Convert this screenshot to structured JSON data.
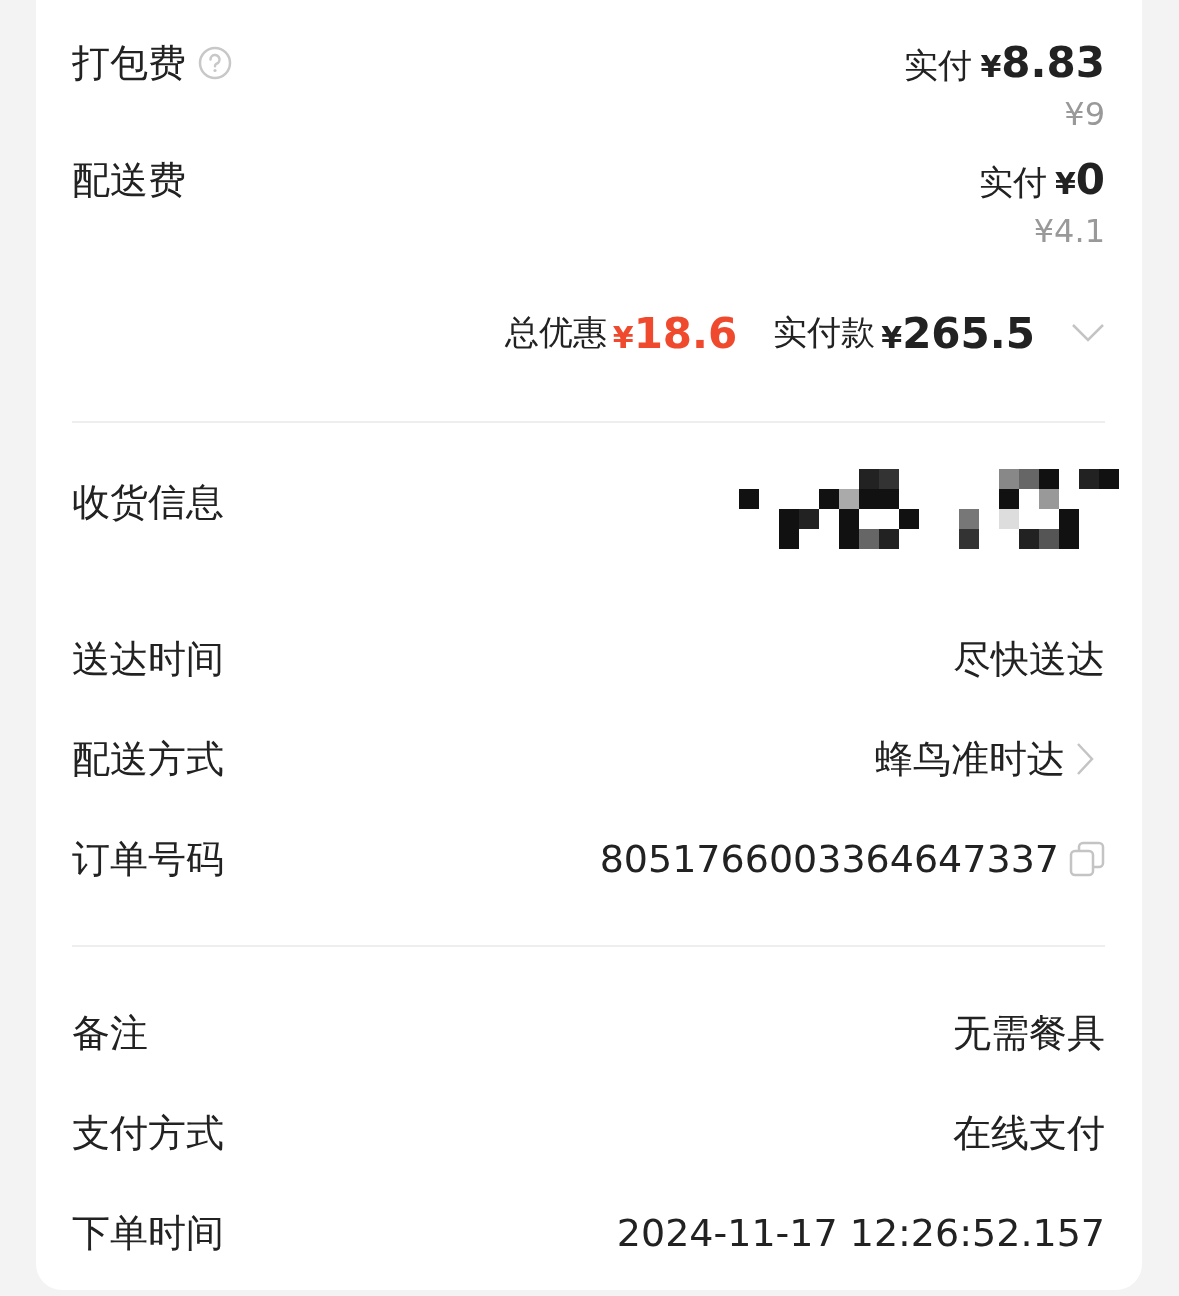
{
  "fees": [
    {
      "label": "打包费",
      "help": true,
      "paid_label": "实付",
      "currency": "¥",
      "paid": "8.83",
      "original": "¥9"
    },
    {
      "label": "配送费",
      "help": false,
      "paid_label": "实付",
      "currency": "¥",
      "paid": "0",
      "original": "¥4.1"
    }
  ],
  "summary": {
    "discount_label": "总优惠",
    "discount_currency": "¥",
    "discount": "18.6",
    "paid_label": "实付款",
    "paid_currency": "¥",
    "paid": "265.5",
    "expanded": false
  },
  "delivery": [
    {
      "kind": "address",
      "label": "收货信息"
    },
    {
      "kind": "text",
      "label": "送达时间",
      "value": "尽快送达"
    },
    {
      "kind": "link",
      "label": "配送方式",
      "value": "蜂鸟准时达"
    },
    {
      "kind": "copy",
      "label": "订单号码",
      "value": "8051766003364647337"
    }
  ],
  "details": [
    {
      "kind": "text",
      "label": "备注",
      "value": "无需餐具"
    },
    {
      "kind": "text",
      "label": "支付方式",
      "value": "在线支付"
    },
    {
      "kind": "text",
      "label": "下单时间",
      "value": "2024-11-17 12:26:52.157"
    }
  ]
}
